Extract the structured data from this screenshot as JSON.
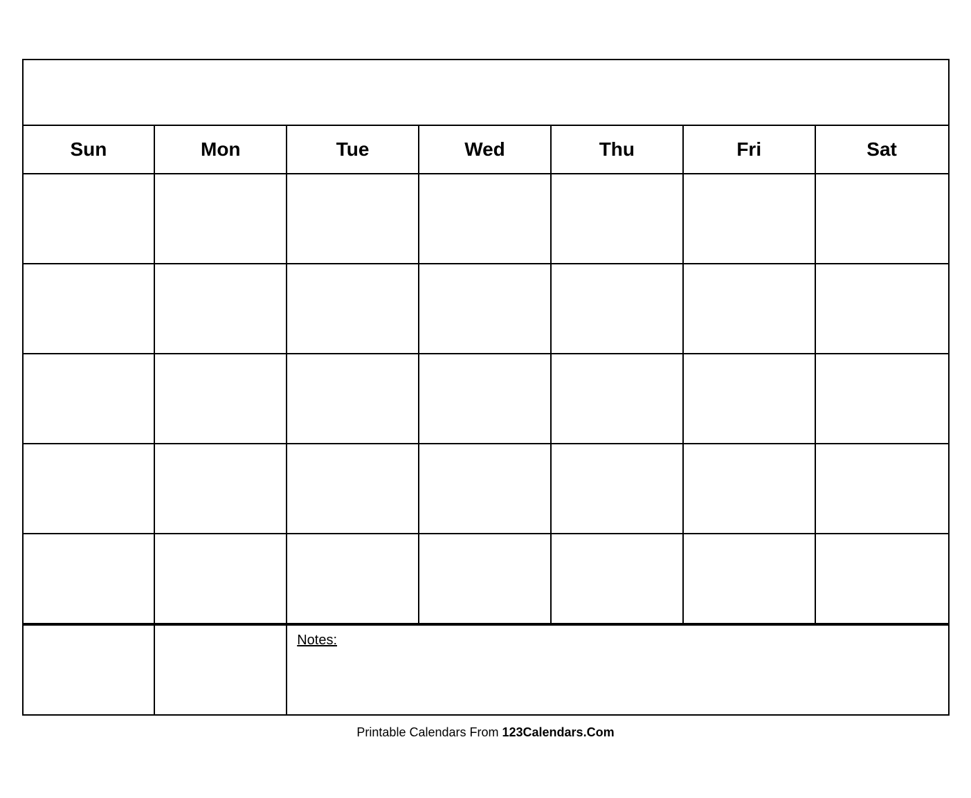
{
  "calendar": {
    "title": "",
    "days": [
      "Sun",
      "Mon",
      "Tue",
      "Wed",
      "Thu",
      "Fri",
      "Sat"
    ],
    "rows": 5,
    "notes_label": "Notes:"
  },
  "footer": {
    "text_normal": "Printable Calendars From ",
    "text_bold": "123Calendars.Com"
  }
}
